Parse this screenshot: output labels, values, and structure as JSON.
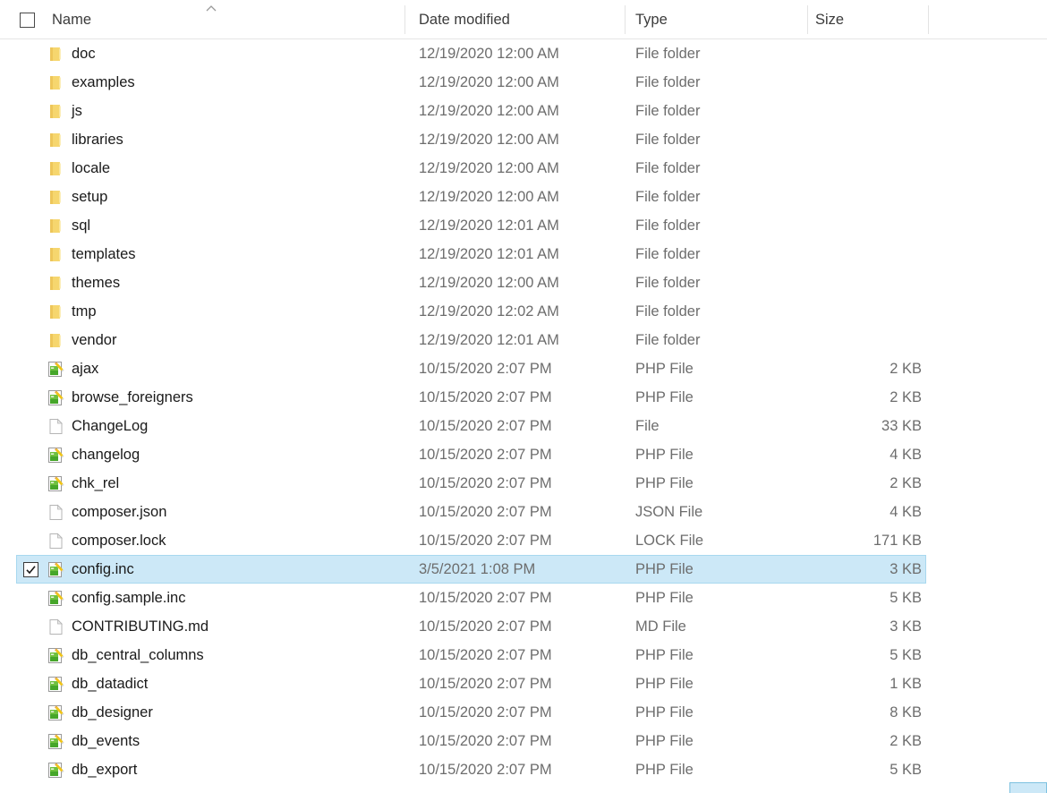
{
  "header": {
    "select_all_checkbox": "unchecked",
    "sort_indicator": "caret-up",
    "sort_column": "Name",
    "columns": [
      {
        "label": "Name"
      },
      {
        "label": "Date modified"
      },
      {
        "label": "Type"
      },
      {
        "label": "Size"
      }
    ]
  },
  "rows": [
    {
      "name": "doc",
      "date": "12/19/2020 12:00 AM",
      "type": "File folder",
      "size": "",
      "icon": "folder-icon",
      "selected": false
    },
    {
      "name": "examples",
      "date": "12/19/2020 12:00 AM",
      "type": "File folder",
      "size": "",
      "icon": "folder-icon",
      "selected": false
    },
    {
      "name": "js",
      "date": "12/19/2020 12:00 AM",
      "type": "File folder",
      "size": "",
      "icon": "folder-icon",
      "selected": false
    },
    {
      "name": "libraries",
      "date": "12/19/2020 12:00 AM",
      "type": "File folder",
      "size": "",
      "icon": "folder-icon",
      "selected": false
    },
    {
      "name": "locale",
      "date": "12/19/2020 12:00 AM",
      "type": "File folder",
      "size": "",
      "icon": "folder-icon",
      "selected": false
    },
    {
      "name": "setup",
      "date": "12/19/2020 12:00 AM",
      "type": "File folder",
      "size": "",
      "icon": "folder-icon",
      "selected": false
    },
    {
      "name": "sql",
      "date": "12/19/2020 12:01 AM",
      "type": "File folder",
      "size": "",
      "icon": "folder-icon",
      "selected": false
    },
    {
      "name": "templates",
      "date": "12/19/2020 12:01 AM",
      "type": "File folder",
      "size": "",
      "icon": "folder-icon",
      "selected": false
    },
    {
      "name": "themes",
      "date": "12/19/2020 12:00 AM",
      "type": "File folder",
      "size": "",
      "icon": "folder-icon",
      "selected": false
    },
    {
      "name": "tmp",
      "date": "12/19/2020 12:02 AM",
      "type": "File folder",
      "size": "",
      "icon": "folder-icon",
      "selected": false
    },
    {
      "name": "vendor",
      "date": "12/19/2020 12:01 AM",
      "type": "File folder",
      "size": "",
      "icon": "folder-icon",
      "selected": false
    },
    {
      "name": "ajax",
      "date": "10/15/2020 2:07 PM",
      "type": "PHP File",
      "size": "2 KB",
      "icon": "php-file-icon",
      "selected": false
    },
    {
      "name": "browse_foreigners",
      "date": "10/15/2020 2:07 PM",
      "type": "PHP File",
      "size": "2 KB",
      "icon": "php-file-icon",
      "selected": false
    },
    {
      "name": "ChangeLog",
      "date": "10/15/2020 2:07 PM",
      "type": "File",
      "size": "33 KB",
      "icon": "generic-file-icon",
      "selected": false
    },
    {
      "name": "changelog",
      "date": "10/15/2020 2:07 PM",
      "type": "PHP File",
      "size": "4 KB",
      "icon": "php-file-icon",
      "selected": false
    },
    {
      "name": "chk_rel",
      "date": "10/15/2020 2:07 PM",
      "type": "PHP File",
      "size": "2 KB",
      "icon": "php-file-icon",
      "selected": false
    },
    {
      "name": "composer.json",
      "date": "10/15/2020 2:07 PM",
      "type": "JSON File",
      "size": "4 KB",
      "icon": "generic-file-icon",
      "selected": false
    },
    {
      "name": "composer.lock",
      "date": "10/15/2020 2:07 PM",
      "type": "LOCK File",
      "size": "171 KB",
      "icon": "generic-file-icon",
      "selected": false
    },
    {
      "name": "config.inc",
      "date": "3/5/2021 1:08 PM",
      "type": "PHP File",
      "size": "3 KB",
      "icon": "php-file-icon",
      "selected": true
    },
    {
      "name": "config.sample.inc",
      "date": "10/15/2020 2:07 PM",
      "type": "PHP File",
      "size": "5 KB",
      "icon": "php-file-icon",
      "selected": false
    },
    {
      "name": "CONTRIBUTING.md",
      "date": "10/15/2020 2:07 PM",
      "type": "MD File",
      "size": "3 KB",
      "icon": "generic-file-icon",
      "selected": false
    },
    {
      "name": "db_central_columns",
      "date": "10/15/2020 2:07 PM",
      "type": "PHP File",
      "size": "5 KB",
      "icon": "php-file-icon",
      "selected": false
    },
    {
      "name": "db_datadict",
      "date": "10/15/2020 2:07 PM",
      "type": "PHP File",
      "size": "1 KB",
      "icon": "php-file-icon",
      "selected": false
    },
    {
      "name": "db_designer",
      "date": "10/15/2020 2:07 PM",
      "type": "PHP File",
      "size": "8 KB",
      "icon": "php-file-icon",
      "selected": false
    },
    {
      "name": "db_events",
      "date": "10/15/2020 2:07 PM",
      "type": "PHP File",
      "size": "2 KB",
      "icon": "php-file-icon",
      "selected": false
    },
    {
      "name": "db_export",
      "date": "10/15/2020 2:07 PM",
      "type": "PHP File",
      "size": "5 KB",
      "icon": "php-file-icon",
      "selected": false
    }
  ],
  "colors": {
    "selection_fill": "#cce8f7",
    "selection_border": "#a8d8ef",
    "folder_icon": "#f7d671",
    "php_icon_green": "#5fb63a",
    "text_primary": "#1a1a1a",
    "text_secondary": "#6d6d6d"
  }
}
